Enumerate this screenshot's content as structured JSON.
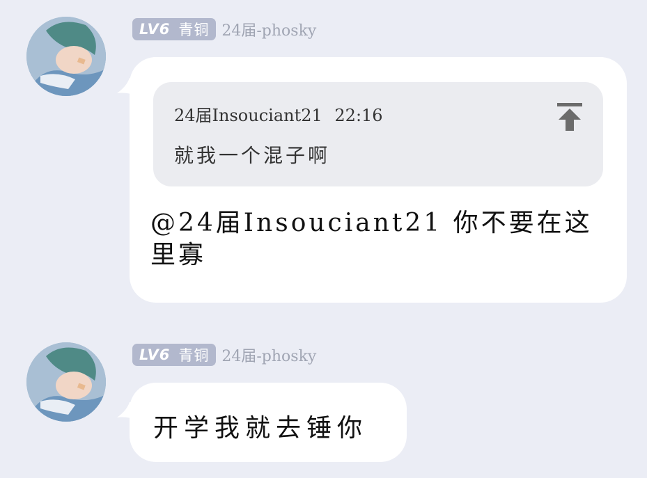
{
  "messages": [
    {
      "level": "LV6",
      "rank": "青铜",
      "sender": "24届-phosky",
      "quote": {
        "author": "24届Insouciant21",
        "time": "22:16",
        "text": "就我一个混子啊"
      },
      "text": "@24届Insouciant21 你不要在这里寡"
    },
    {
      "level": "LV6",
      "rank": "青铜",
      "sender": "24届-phosky",
      "text": "开学我就去锤你"
    }
  ],
  "icons": {
    "avatar": "anime-sleeping-avatar",
    "jump": "arrow-up-to-top-icon"
  },
  "colors": {
    "background": "#ebedf5",
    "bubble": "#ffffff",
    "badge": "#b2b8cd",
    "quote_bg": "#ebecf0"
  }
}
